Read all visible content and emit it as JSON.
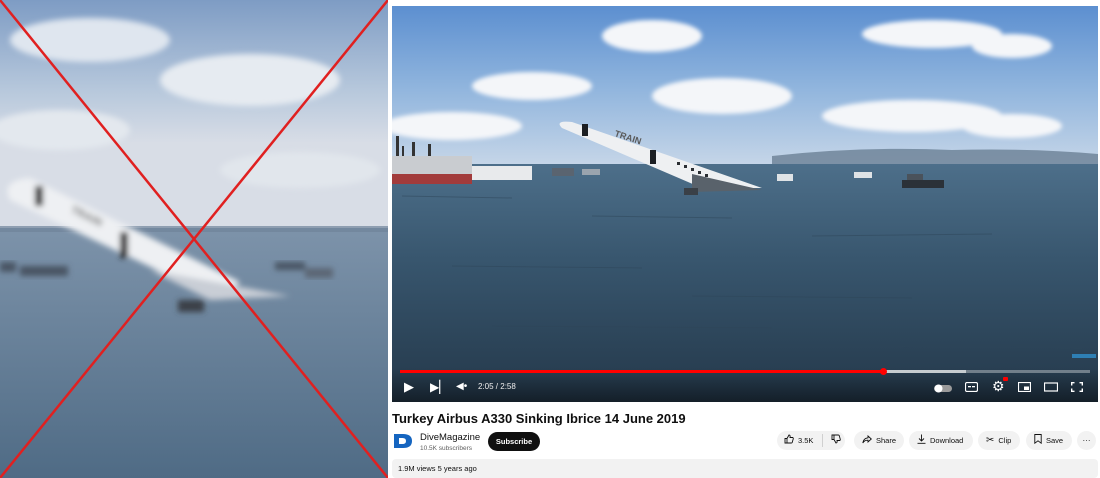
{
  "video": {
    "title": "Turkey Airbus A330 Sinking Ibrice 14 June 2019",
    "current_time": "2:05",
    "duration": "2:58",
    "time_display": "2:05 / 2:58",
    "progress_fraction": 0.7,
    "buffered_fraction": 0.82
  },
  "left_image": {
    "aircraft_livery_text": "TRAIN",
    "cross_color": "#e02020"
  },
  "channel": {
    "logo_letter": "D",
    "logo_color": "#1565c0",
    "name": "DiveMagazine",
    "subscribers": "10.5K subscribers",
    "subscribe_label": "Subscribe"
  },
  "actions": {
    "like_count": "3.5K",
    "share_label": "Share",
    "download_label": "Download",
    "clip_label": "Clip",
    "save_label": "Save",
    "more_label": "···"
  },
  "description": {
    "views": "1.9M views",
    "age": "5 years ago",
    "summary": "1.9M views  5 years ago"
  },
  "icons": {
    "play": "play-icon",
    "next": "next-icon",
    "volume": "volume-icon",
    "autoplay": "autoplay-toggle-icon",
    "subtitles": "subtitles-icon",
    "settings": "settings-icon",
    "miniplayer": "miniplayer-icon",
    "theater": "theater-icon",
    "fullscreen": "fullscreen-icon"
  },
  "colors": {
    "accent_red": "#ff0000",
    "subscribe_bg": "#0f0f0f",
    "settings_badge": "#ff0000"
  }
}
